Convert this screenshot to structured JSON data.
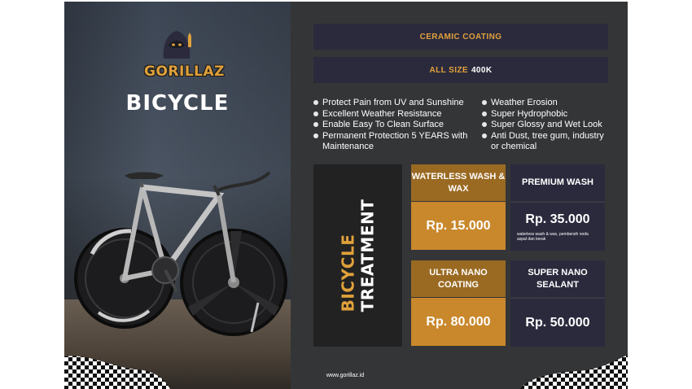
{
  "brand": {
    "name": "GORILLAZ",
    "website": "www.gorillaz.id"
  },
  "title": "BICYCLE",
  "ceramic": {
    "label": "CERAMIC COATING",
    "size_label": "ALL SIZE",
    "size_price": "400K"
  },
  "features_left": [
    "Protect Pain from UV and Sunshine",
    "Excellent Weather Resistance",
    "Enable Easy To Clean Surface",
    "Permanent Protection 5 YEARS with Maintenance"
  ],
  "features_right": [
    "Weather Erosion",
    "Super Hydrophobic",
    "Super Glossy and Wet Look",
    "Anti Dust, tree gum, industry or chemical"
  ],
  "treatment": {
    "word1": "BICYCLE",
    "word2": "TREATMENT"
  },
  "services": {
    "waterless": {
      "name": "WATERLESS WASH & WAX",
      "price": "Rp. 15.000"
    },
    "premium": {
      "name": "PREMIUM WASH",
      "price": "Rp. 35.000",
      "note": "waterless wash & wax, pembersih noda aspal dan kerak"
    },
    "ultra": {
      "name": "ULTRA NANO COATING",
      "price": "Rp. 80.000"
    },
    "super": {
      "name": "SUPER NANO SEALANT",
      "price": "Rp. 50.000"
    }
  },
  "colors": {
    "accent": "#e0a13a",
    "gold_card": "#c9882c",
    "navy": "#2b2a3d",
    "background": "#343537"
  },
  "icons": [
    "gorilla-logo-icon",
    "bicycle-illustration",
    "checkered-flag-icon"
  ]
}
